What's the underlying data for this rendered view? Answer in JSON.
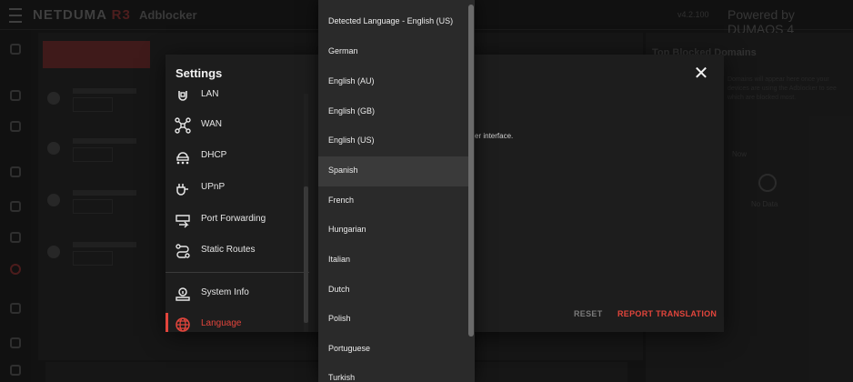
{
  "app": {
    "brand_prefix": "NETDUMA",
    "brand_model": "R3",
    "section": "Adblocker",
    "status": "v4.2.100",
    "powered_by": "Powered by DUMAOS 4"
  },
  "background": {
    "add_button": "+ ADD BLOCKLIST",
    "rows": [
      {
        "title": "OPPO Reno10 5G",
        "sub": "Disabled"
      },
      {
        "title": "OPPO Reno10 5G",
        "sub": "Disabled"
      },
      {
        "title": "MIT WiFi",
        "sub": "Disabled"
      },
      {
        "title": "WiFi HUB",
        "sub": "Disabled"
      }
    ],
    "right_title": "Top Blocked Domains",
    "right_text": "Domains will appear here once your devices are using the Adblocker to see which are blocked most.",
    "right_now": "Now",
    "right_nodata": "No Data"
  },
  "modal": {
    "title": "Settings",
    "description": "er interface.",
    "reset_label": "RESET",
    "report_label": "REPORT TRANSLATION",
    "nav_items": [
      {
        "label": "LAN",
        "icon": "lan-icon"
      },
      {
        "label": "WAN",
        "icon": "wan-icon"
      },
      {
        "label": "DHCP",
        "icon": "dhcp-icon"
      },
      {
        "label": "UPnP",
        "icon": "upnp-icon"
      },
      {
        "label": "Port Forwarding",
        "icon": "port-forwarding-icon"
      },
      {
        "label": "Static Routes",
        "icon": "static-routes-icon"
      },
      {
        "label": "System Info",
        "icon": "system-info-icon"
      },
      {
        "label": "Language",
        "icon": "globe-icon",
        "active": true
      }
    ]
  },
  "language_dropdown": {
    "options": [
      "Detected Language - English (US)",
      "German",
      "English (AU)",
      "English (GB)",
      "English (US)",
      "Spanish",
      "French",
      "Hungarian",
      "Italian",
      "Dutch",
      "Polish",
      "Portuguese",
      "Turkish"
    ],
    "highlighted": "Spanish"
  },
  "colors": {
    "accent": "#e2453c",
    "background": "#161616",
    "modal": "#1d1d1d",
    "dropdown": "#2a2a2a"
  }
}
